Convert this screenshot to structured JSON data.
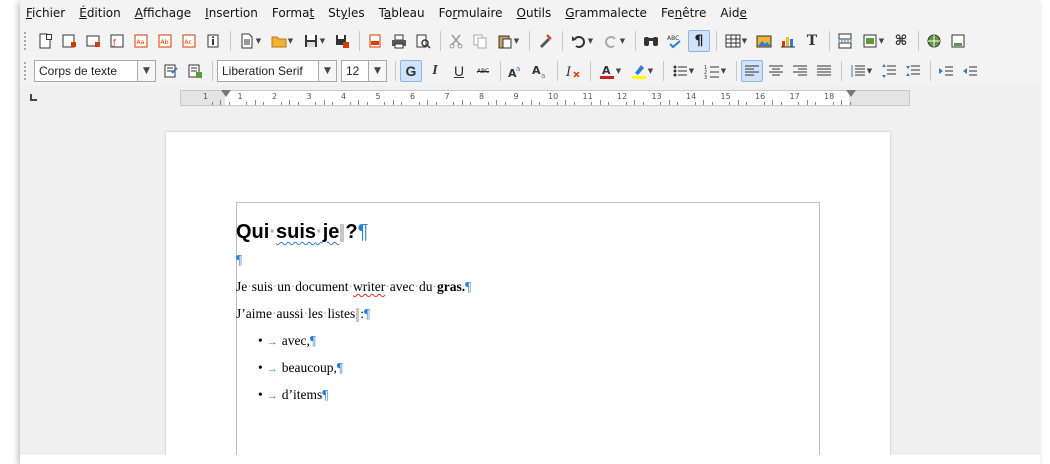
{
  "menubar": {
    "items": [
      {
        "pre": "",
        "acc": "F",
        "post": "ichier"
      },
      {
        "pre": "",
        "acc": "É",
        "post": "dition"
      },
      {
        "pre": "",
        "acc": "A",
        "post": "ffichage"
      },
      {
        "pre": "",
        "acc": "I",
        "post": "nsertion"
      },
      {
        "pre": "Forma",
        "acc": "t",
        "post": ""
      },
      {
        "pre": "St",
        "acc": "y",
        "post": "les"
      },
      {
        "pre": "T",
        "acc": "a",
        "post": "bleau"
      },
      {
        "pre": "Fo",
        "acc": "r",
        "post": "mulaire"
      },
      {
        "pre": "",
        "acc": "O",
        "post": "utils"
      },
      {
        "pre": "",
        "acc": "G",
        "post": "rammalecte"
      },
      {
        "pre": "Fe",
        "acc": "n",
        "post": "être"
      },
      {
        "pre": "Aid",
        "acc": "e",
        "post": ""
      }
    ]
  },
  "format_toolbar": {
    "paragraph_style": "Corps de texte",
    "font_name": "Liberation Serif",
    "font_size": "12",
    "bold_label": "G",
    "italic_label": "I",
    "underline_label": "U",
    "strike_label": "ABC"
  },
  "ruler": {
    "numbers": [
      "1",
      "1",
      "2",
      "3",
      "4",
      "5",
      "6",
      "7",
      "8",
      "9",
      "10",
      "11",
      "12",
      "13",
      "14",
      "15",
      "16",
      "17",
      "18"
    ]
  },
  "document": {
    "heading_parts": {
      "w1": "Qui",
      "w2": "suis",
      "w3": "je",
      "w4": "?"
    },
    "pilcrow": "¶",
    "line1": {
      "pre": "Je",
      "w2": "suis",
      "w3": "un",
      "w4": "document",
      "spell": "writer",
      "w6": "avec",
      "w7": "du",
      "bold": "gras."
    },
    "line2": {
      "w1": "J’aime",
      "w2": "aussi",
      "w3": "les",
      "w4": "listes",
      "w5": ":"
    },
    "bullet_char": "•",
    "tab_arrow": "→",
    "list_items": [
      "avec,",
      "beaucoup,",
      "d’items"
    ],
    "space_dot": "·"
  },
  "colors": {
    "formatting_marks": "#2a7fd4",
    "spell_error": "#e03030",
    "active_button": "#cfe2f7"
  }
}
